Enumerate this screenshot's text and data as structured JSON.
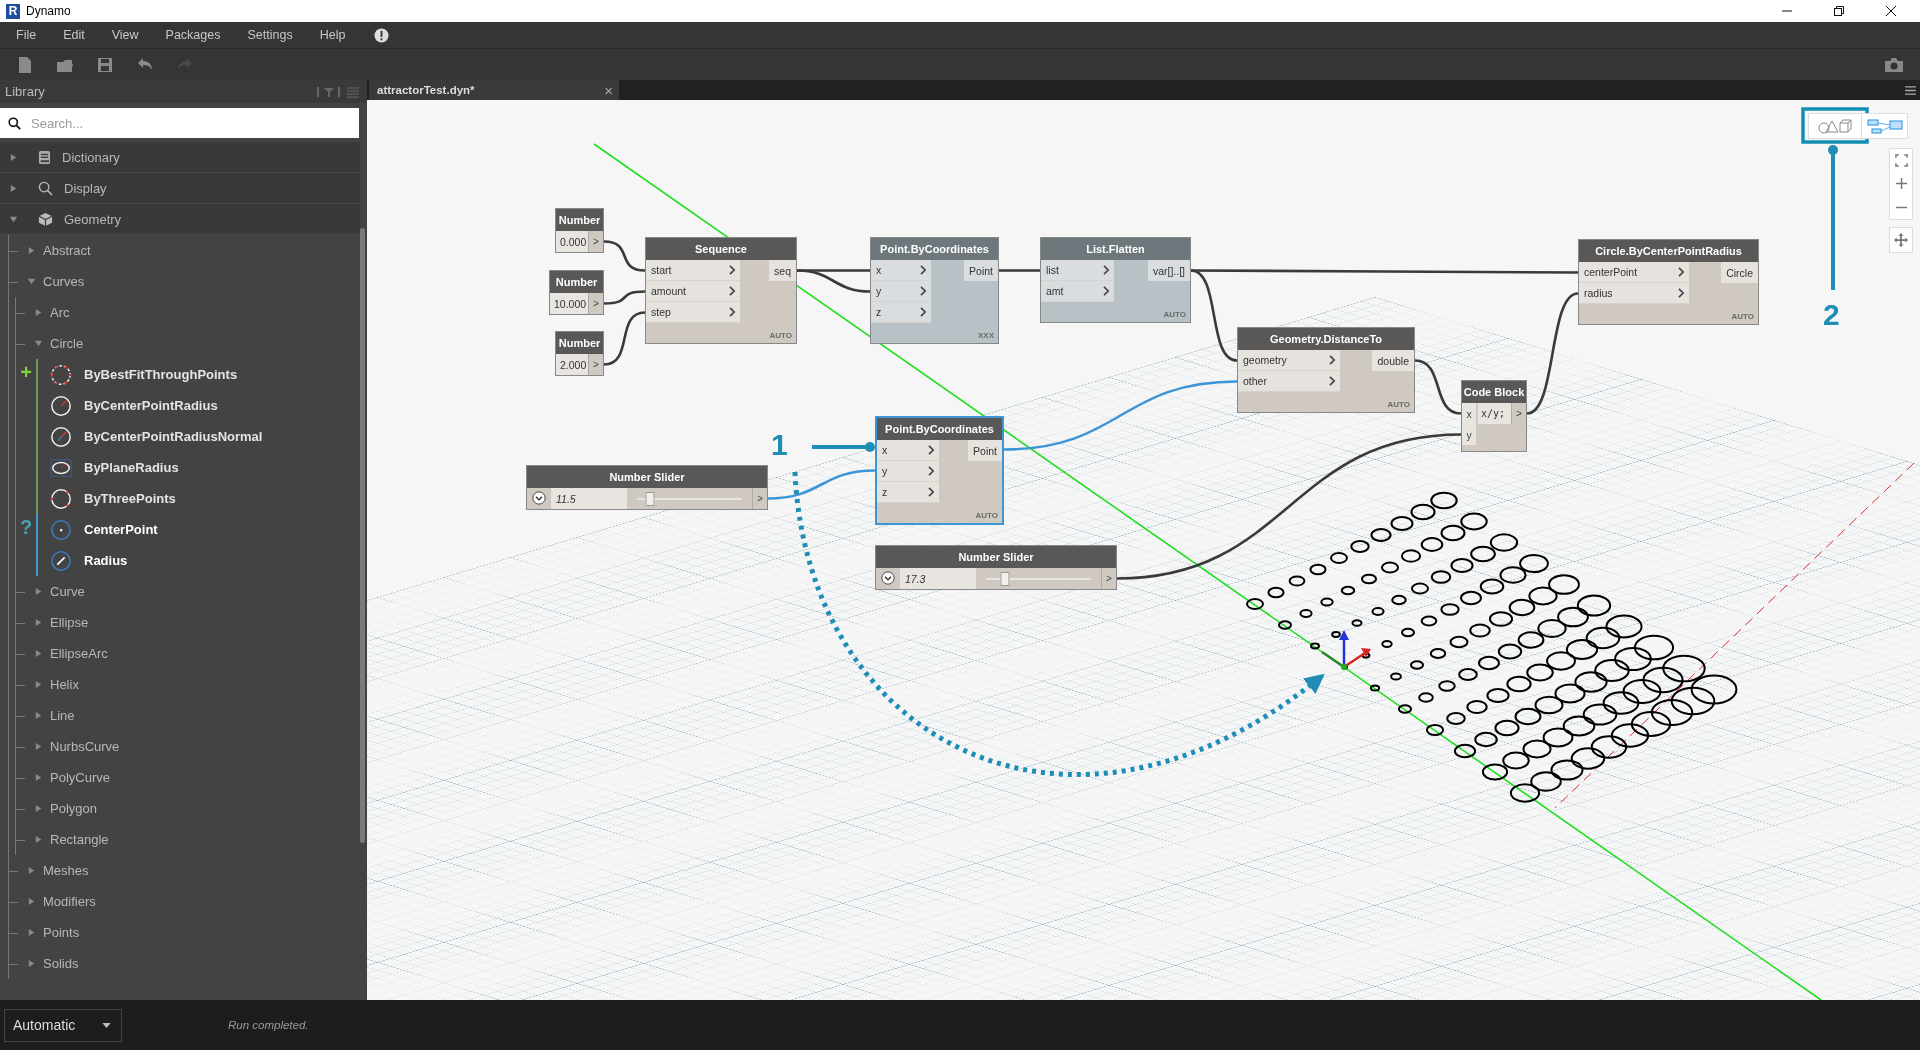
{
  "window": {
    "logo": "R",
    "title": "Dynamo"
  },
  "menu": [
    "File",
    "Edit",
    "View",
    "Packages",
    "Settings",
    "Help"
  ],
  "toolbar": [
    {
      "kind": "new",
      "disabled": false
    },
    {
      "kind": "open",
      "disabled": false
    },
    {
      "kind": "save",
      "disabled": false
    },
    {
      "kind": "undo",
      "disabled": false
    },
    {
      "kind": "redo",
      "disabled": true
    }
  ],
  "library": {
    "title": "Library",
    "search": {
      "placeholder": "Search..."
    },
    "items": [
      {
        "label": "Dictionary",
        "expanded": false
      },
      {
        "label": "Display",
        "expanded": false
      },
      {
        "label": "Geometry",
        "expanded": true,
        "children": [
          {
            "label": "Abstract",
            "expanded": false
          },
          {
            "label": "Curves",
            "expanded": true,
            "children": [
              {
                "label": "Arc",
                "expanded": false
              },
              {
                "label": "Circle",
                "expanded": true,
                "groups": [
                  {
                    "kind": "create",
                    "symbol": "+",
                    "members": [
                      "ByBestFitThroughPoints",
                      "ByCenterPointRadius",
                      "ByCenterPointRadiusNormal",
                      "ByPlaneRadius",
                      "ByThreePoints"
                    ]
                  },
                  {
                    "kind": "query",
                    "symbol": "?",
                    "members": [
                      "CenterPoint",
                      "Radius"
                    ]
                  }
                ]
              },
              {
                "label": "Curve",
                "expanded": false
              },
              {
                "label": "Ellipse",
                "expanded": false
              },
              {
                "label": "EllipseArc",
                "expanded": false
              },
              {
                "label": "Helix",
                "expanded": false
              },
              {
                "label": "Line",
                "expanded": false
              },
              {
                "label": "NurbsCurve",
                "expanded": false
              },
              {
                "label": "PolyCurve",
                "expanded": false
              },
              {
                "label": "Polygon",
                "expanded": false
              },
              {
                "label": "Rectangle",
                "expanded": false
              }
            ]
          },
          {
            "label": "Meshes",
            "expanded": false
          },
          {
            "label": "Modifiers",
            "expanded": false
          },
          {
            "label": "Points",
            "expanded": false
          },
          {
            "label": "Solids",
            "expanded": false
          }
        ]
      }
    ]
  },
  "tab": {
    "title": "attractorTest.dyn*",
    "close": "×"
  },
  "view_buttons": [
    {
      "kind": "geometry",
      "selected": false
    },
    {
      "kind": "graph",
      "selected": true
    }
  ],
  "nodes": [
    {
      "kind": "number",
      "title": "Number",
      "value": "0.000",
      "output": ">"
    },
    {
      "kind": "number",
      "title": "Number",
      "value": "10.000",
      "output": ">"
    },
    {
      "kind": "number",
      "title": "Number",
      "value": "2.000",
      "output": ">"
    },
    {
      "kind": "function",
      "title": "Sequence",
      "inputs": [
        "start",
        "amount",
        "step"
      ],
      "outputs": [
        "seq"
      ],
      "lacing": "AUTO",
      "preview": true,
      "selected": false
    },
    {
      "kind": "function",
      "title": "Point.ByCoordinates",
      "inputs": [
        "x",
        "y",
        "z"
      ],
      "outputs": [
        "Point"
      ],
      "lacing": "XXX",
      "preview": false,
      "selected": false
    },
    {
      "kind": "function",
      "title": "List.Flatten",
      "inputs": [
        "list",
        "amt"
      ],
      "outputs": [
        "var[]..[]"
      ],
      "lacing": "AUTO",
      "preview": false,
      "selected": false
    },
    {
      "kind": "function",
      "title": "Circle.ByCenterPointRadius",
      "inputs": [
        "centerPoint",
        "radius"
      ],
      "outputs": [
        "Circle"
      ],
      "lacing": "AUTO",
      "preview": true,
      "selected": false
    },
    {
      "kind": "function",
      "title": "Geometry.DistanceTo",
      "inputs": [
        "geometry",
        "other"
      ],
      "outputs": [
        "double"
      ],
      "lacing": "AUTO",
      "preview": true,
      "selected": false
    },
    {
      "kind": "code",
      "title": "Code Block",
      "inputs": [
        "x",
        "y"
      ],
      "code": "x/y;",
      "output": ">"
    },
    {
      "kind": "function",
      "title": "Point.ByCoordinates",
      "inputs": [
        "x",
        "y",
        "z"
      ],
      "outputs": [
        "Point"
      ],
      "lacing": "AUTO",
      "preview": true,
      "selected": true
    },
    {
      "kind": "slider",
      "title": "Number Slider",
      "value": "11.5",
      "level": 0.12,
      "output": ">"
    },
    {
      "kind": "slider",
      "title": "Number Slider",
      "value": "17.3",
      "level": 0.18,
      "output": ">"
    }
  ],
  "annotations": [
    "1",
    "2"
  ],
  "status_bar": {
    "run_mode": "Automatic",
    "message": "Run completed."
  }
}
